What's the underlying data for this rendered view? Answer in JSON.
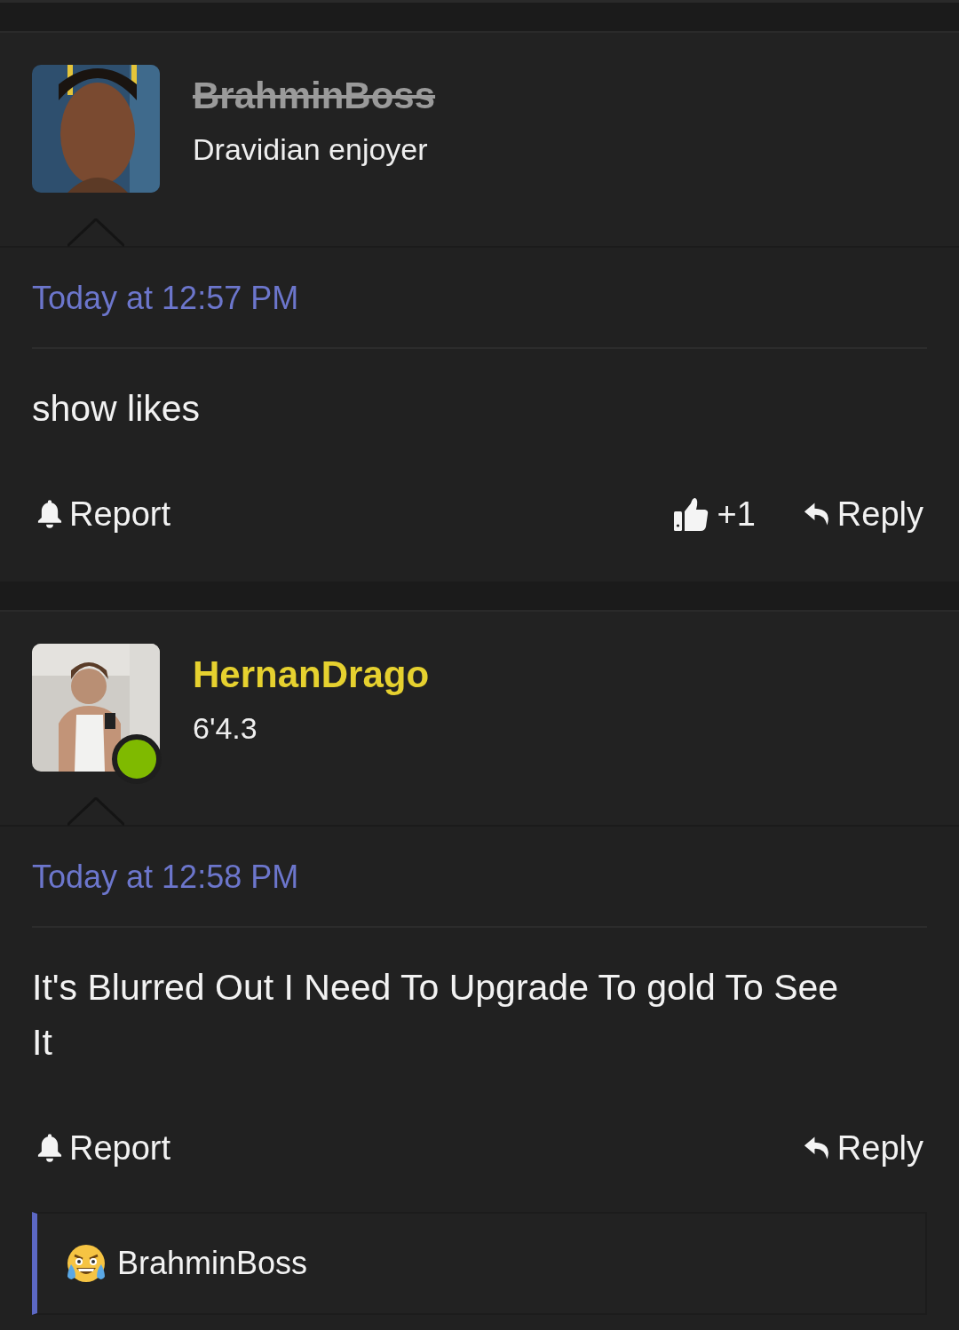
{
  "posts": [
    {
      "username": "BrahminBoss",
      "struck": true,
      "color": "#9a9a9a",
      "user_title": "Dravidian enjoyer",
      "online": false,
      "avatar": {
        "kind": "picture"
      },
      "time": "Today at 12:57 PM",
      "message": "show likes",
      "report": "Report",
      "likes": "+1",
      "reply": "Reply"
    },
    {
      "username": "HernanDrago",
      "struck": false,
      "color": "#e6d12f",
      "user_title": "6'4.3",
      "online": true,
      "avatar": {
        "kind": "picture"
      },
      "time": "Today at 12:58 PM",
      "message": "It's Blurred Out I Need To Upgrade To gold To See It",
      "report": "Report",
      "reply": "Reply",
      "reactions": [
        {
          "user": "BrahminBoss"
        }
      ]
    }
  ]
}
